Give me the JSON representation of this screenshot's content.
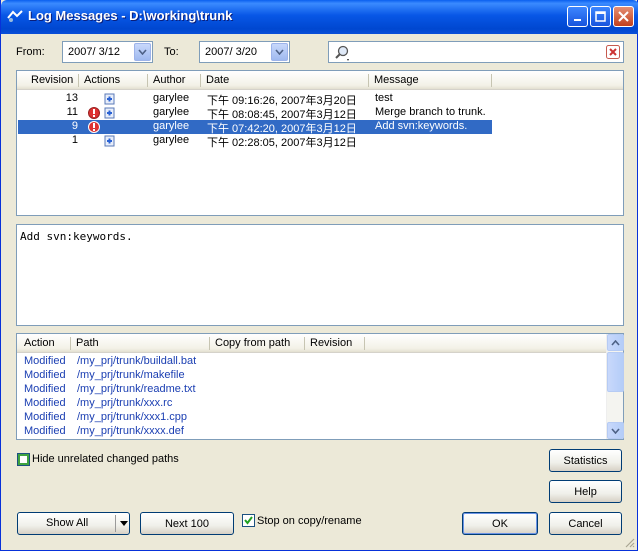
{
  "window": {
    "title": "Log Messages - D:\\working\\trunk"
  },
  "filter": {
    "from_label": "From:",
    "from_value": "2007/  3/12",
    "to_label": "To:",
    "to_value": "2007/  3/20",
    "search_value": ""
  },
  "log": {
    "columns": [
      "Revision",
      "Actions",
      "Author",
      "Date",
      "Message"
    ],
    "rows": [
      {
        "revision": "13",
        "action_icon": "add-icon",
        "author": "garylee",
        "date": "下午 09:16:26, 2007年3月20日",
        "message": "test",
        "selected": false
      },
      {
        "revision": "11",
        "action_icon": "modify-icon",
        "author": "garylee",
        "date": "下午 08:08:45, 2007年3月12日",
        "message": "Merge branch to trunk.",
        "selected": false
      },
      {
        "revision": "9",
        "action_icon": "modify-icon",
        "author": "garylee",
        "date": "下午 07:42:20, 2007年3月12日",
        "message": "Add svn:keywords.",
        "selected": true
      },
      {
        "revision": "1",
        "action_icon": "add-icon",
        "author": "garylee",
        "date": "下午 02:28:05, 2007年3月12日",
        "message": "",
        "selected": false
      }
    ]
  },
  "message_box": {
    "text": "Add svn:keywords."
  },
  "paths": {
    "columns": [
      "Action",
      "Path",
      "Copy from path",
      "Revision"
    ],
    "rows": [
      {
        "action": "Modified",
        "path": "/my_prj/trunk/buildall.bat"
      },
      {
        "action": "Modified",
        "path": "/my_prj/trunk/makefile"
      },
      {
        "action": "Modified",
        "path": "/my_prj/trunk/readme.txt"
      },
      {
        "action": "Modified",
        "path": "/my_prj/trunk/xxx.rc"
      },
      {
        "action": "Modified",
        "path": "/my_prj/trunk/xxx1.cpp"
      },
      {
        "action": "Modified",
        "path": "/my_prj/trunk/xxxx.def"
      }
    ]
  },
  "options": {
    "hide_unrelated_label": "Hide unrelated changed paths",
    "hide_unrelated_checked": false,
    "stop_on_copy_label": "Stop on copy/rename",
    "stop_on_copy_checked": true
  },
  "buttons": {
    "statistics": "Statistics",
    "help": "Help",
    "show_all": "Show All",
    "next_100": "Next 100",
    "ok": "OK",
    "cancel": "Cancel"
  },
  "colors": {
    "title_bar": "#0a5fef",
    "selection": "#316ac5",
    "path_text": "#1a3eb2"
  }
}
